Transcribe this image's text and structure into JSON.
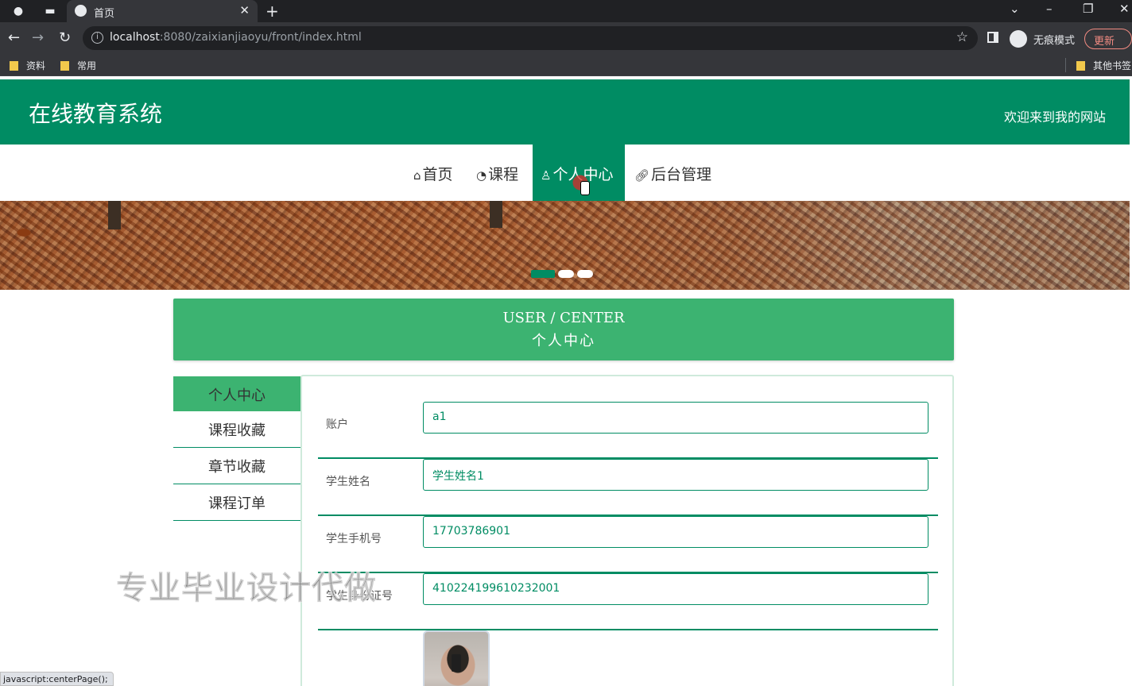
{
  "browser": {
    "tab_title": "首页",
    "url_host": "localhost",
    "url_rest": ":8080/zaixianjiaoyu/front/index.html",
    "incognito_label": "无痕模式",
    "update_label": "更新",
    "bookmarks": [
      "资料",
      "常用"
    ],
    "other_bookmarks": "其他书签"
  },
  "site": {
    "title": "在线教育系统",
    "welcome": "欢迎来到我的网站"
  },
  "nav": {
    "items": [
      {
        "label": "首页",
        "icon": "home-icon"
      },
      {
        "label": "课程",
        "icon": "dashboard-icon"
      },
      {
        "label": "个人中心",
        "icon": "user-icon",
        "active": true
      },
      {
        "label": "后台管理",
        "icon": "link-icon"
      }
    ]
  },
  "banner": {
    "active_slide": 1,
    "slide_count": 3
  },
  "center": {
    "title_en": "USER / CENTER",
    "title_cn": "个人中心"
  },
  "sidebar": {
    "items": [
      "个人中心",
      "课程收藏",
      "章节收藏",
      "课程订单"
    ],
    "active_index": 0
  },
  "form": {
    "fields": [
      {
        "label": "账户",
        "value": "a1"
      },
      {
        "label": "学生姓名",
        "value": "学生姓名1"
      },
      {
        "label": "学生手机号",
        "value": "17703786901"
      },
      {
        "label": "学生身份证号",
        "value": "410224199610232001"
      }
    ]
  },
  "watermark": "专业毕业设计代做",
  "status_text": "javascript:centerPage();",
  "colors": {
    "primary": "#008c63",
    "accent": "#3cb371"
  }
}
